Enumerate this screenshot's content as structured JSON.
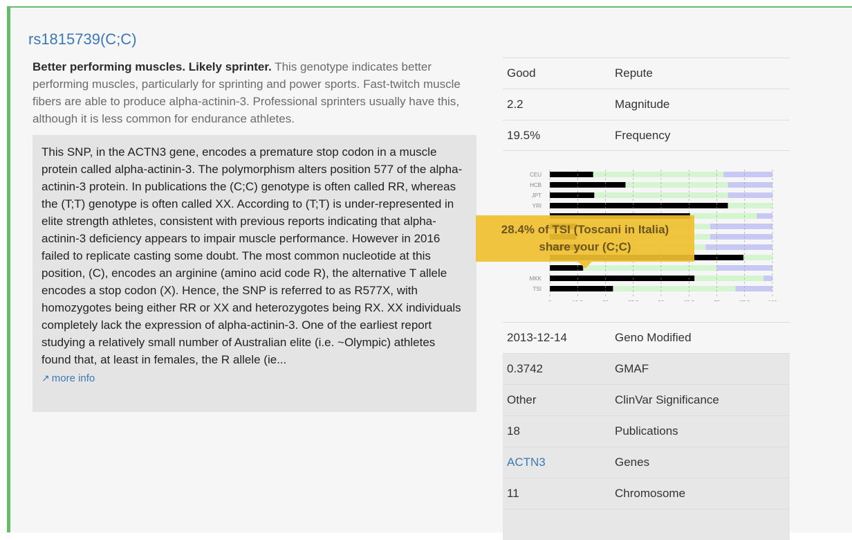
{
  "snp": {
    "title": "rs1815739(C;C)",
    "summary_bold": "Better performing muscles. Likely sprinter.",
    "summary_rest": " This genotype indicates better performing muscles, particularly for sprinting and power sports. Fast-twitch muscle fibers are able to produce alpha-actinin-3. Professional sprinters usually have this, although it is less common for endurance athletes.",
    "description": "This SNP, in the ACTN3 gene, encodes a premature stop codon in a muscle protein called alpha-actinin-3. The polymorphism alters position 577 of the alpha-actinin-3 protein. In publications the (C;C) genotype is often called RR, whereas the (T;T) genotype is often called XX. According to (T;T) is under-represented in elite strength athletes, consistent with previous reports indicating that alpha-actinin-3 deficiency appears to impair muscle performance. However in 2016 failed to replicate casting some doubt. The most common nucleotide at this position, (C), encodes an arginine (amino acid code R), the alternative T allele encodes a stop codon (X). Hence, the SNP is referred to as R577X, with homozygotes being either RR or XX and heterozygotes being RX. XX individuals completely lack the expression of alpha-actinin-3. One of the earliest report studying a relatively small number of Australian elite (i.e. ~Olympic) athletes found that, at least in females, the R allele (ie...",
    "more_info": "more info"
  },
  "attributes_top": [
    {
      "value": "Good",
      "key": "Repute"
    },
    {
      "value": "2.2",
      "key": "Magnitude"
    },
    {
      "value": "19.5%",
      "key": "Frequency"
    }
  ],
  "attributes_bottom": [
    {
      "value": "2013-12-14",
      "key": "Geno Modified",
      "shaded": false,
      "link": false
    },
    {
      "value": "0.3742",
      "key": "GMAF",
      "shaded": true,
      "link": false
    },
    {
      "value": "Other",
      "key": "ClinVar Significance",
      "shaded": true,
      "link": false
    },
    {
      "value": "18",
      "key": "Publications",
      "shaded": true,
      "link": false
    },
    {
      "value": "ACTN3",
      "key": "Genes",
      "shaded": true,
      "link": true
    },
    {
      "value": "11",
      "key": "Chromosome",
      "shaded": true,
      "link": false
    }
  ],
  "tooltip": {
    "line1": "28.4% of TSI (Toscani in Italia)",
    "line2": "share your (C;C)"
  },
  "chart_data": {
    "type": "bar",
    "stacked": true,
    "horizontal": true,
    "colors": {
      "cc": "#000000",
      "ct": "#d4f5d0",
      "tt": "#c8c8f5"
    },
    "xticks": [
      "0",
      "12.5",
      "25",
      "37.5",
      "50",
      "62.5",
      "75",
      "87.5",
      "100"
    ],
    "xlim": [
      0,
      100
    ],
    "categories": [
      "CEU",
      "HCB",
      "JPT",
      "YRI",
      "",
      "",
      "",
      "",
      "",
      "",
      "MKK",
      "TSI"
    ],
    "series": [
      {
        "values": [
          19.5,
          34,
          20,
          80,
          63,
          12,
          12,
          14,
          87,
          15,
          65,
          28.4
        ]
      },
      {
        "values": [
          58.5,
          46,
          60,
          20,
          30,
          60,
          60,
          56,
          13,
          60,
          31,
          55
        ]
      },
      {
        "values": [
          22,
          20,
          20,
          0,
          7,
          28,
          28,
          30,
          0,
          25,
          4,
          16.6
        ]
      }
    ]
  }
}
